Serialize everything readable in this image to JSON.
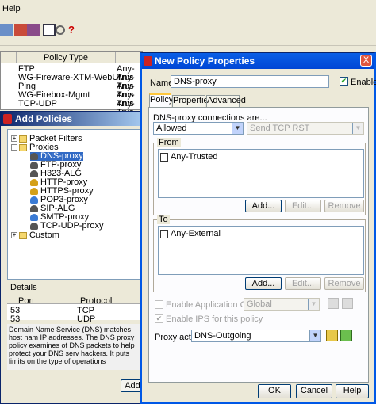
{
  "menubar": {
    "help": "Help"
  },
  "policy_table": {
    "header": "Policy Type",
    "rows": [
      {
        "type": "FTP",
        "from": "Any-Trus"
      },
      {
        "type": "WG-Fireware-XTM-WebUI",
        "from": "Any-Trus"
      },
      {
        "type": "Ping",
        "from": "Any-Trus"
      },
      {
        "type": "WG-Firebox-Mgmt",
        "from": "Any-Trus"
      },
      {
        "type": "TCP-UDP",
        "from": "Any-Trus"
      }
    ]
  },
  "add_policies": {
    "title": "Add Policies",
    "tree": {
      "packet_filters": "Packet Filters",
      "proxies": "Proxies",
      "items": [
        "DNS-proxy",
        "FTP-proxy",
        "H323-ALG",
        "HTTP-proxy",
        "HTTPS-proxy",
        "POP3-proxy",
        "SIP-ALG",
        "SMTP-proxy",
        "TCP-UDP-proxy"
      ],
      "custom": "Custom"
    },
    "details": {
      "label": "Details",
      "columns": [
        "Port",
        "Protocol"
      ],
      "rows": [
        [
          "53",
          "TCP"
        ],
        [
          "53",
          "UDP"
        ]
      ],
      "description": "Domain Name Service (DNS) matches host nam IP addresses. The DNS proxy policy examines of DNS packets to help protect your DNS serv hackers. It puts limits on the type of operations"
    },
    "add_button": "Add"
  },
  "dialog": {
    "title": "New Policy Properties",
    "close": "X",
    "name_label": "Name:",
    "name_value": "DNS-proxy",
    "enable_label": "Enable",
    "tabs": [
      "Policy",
      "Properties",
      "Advanced"
    ],
    "connections_label": "DNS-proxy connections are...",
    "connections_value": "Allowed",
    "send_rst": "Send TCP RST",
    "from": {
      "label": "From",
      "entry": "Any-Trusted",
      "add": "Add...",
      "edit": "Edit...",
      "remove": "Remove"
    },
    "to": {
      "label": "To",
      "entry": "Any-External",
      "add": "Add...",
      "edit": "Edit...",
      "remove": "Remove"
    },
    "app_control_label": "Enable Application Control:",
    "app_control_value": "Global",
    "ips_label": "Enable IPS for this policy",
    "proxy_action_label": "Proxy action:",
    "proxy_action_value": "DNS-Outgoing",
    "ok": "OK",
    "cancel": "Cancel",
    "help": "Help"
  },
  "colors": {
    "title_bar": "#0a5fe6",
    "window_bg": "#ece9d8"
  }
}
